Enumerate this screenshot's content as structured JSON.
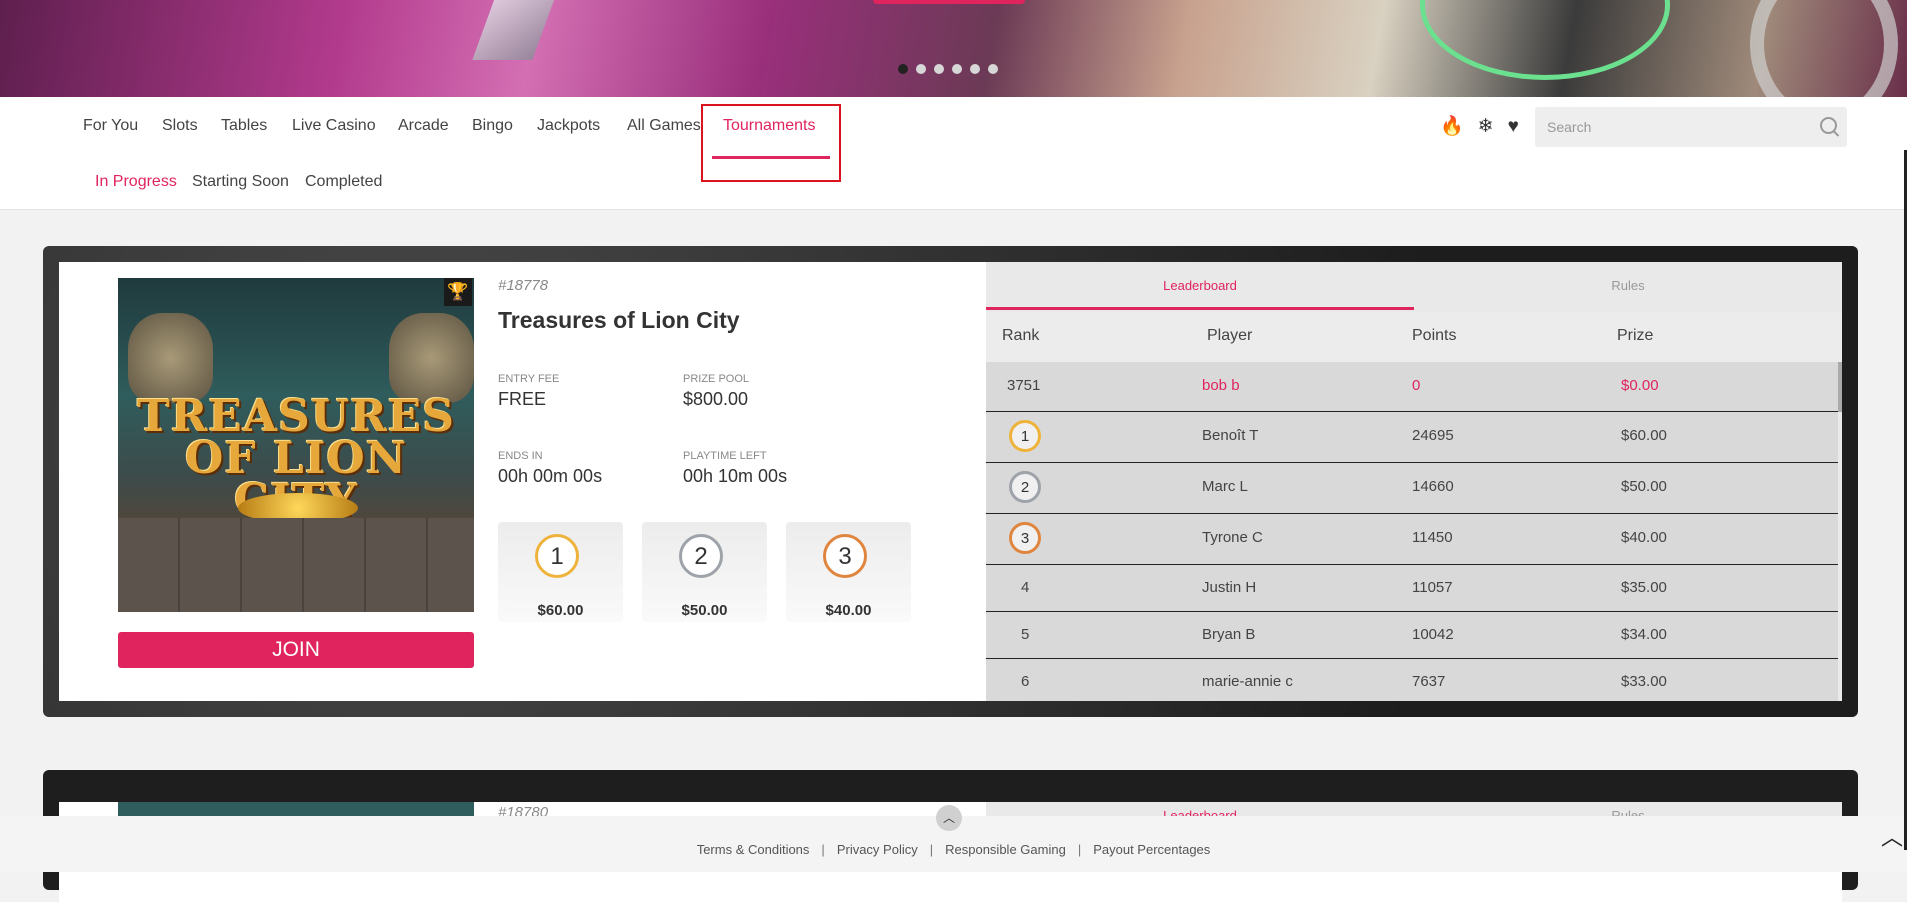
{
  "nav": {
    "items": [
      "For You",
      "Slots",
      "Tables",
      "Live Casino",
      "Arcade",
      "Bingo",
      "Jackpots",
      "All Games",
      "Tournaments"
    ],
    "active": "Tournaments",
    "sub_items": [
      "In Progress",
      "Starting Soon",
      "Completed"
    ],
    "sub_active": "In Progress",
    "icons": [
      "fire-icon",
      "snowflake-icon",
      "heart-icon"
    ],
    "search_placeholder": "Search"
  },
  "carousel": {
    "slide_count": 6,
    "active_index": 0
  },
  "tournament": {
    "id": "#18778",
    "name": "Treasures of Lion City",
    "game_art_title": "TREASURES OF LION CITY",
    "entry_fee_label": "ENTRY FEE",
    "entry_fee": "FREE",
    "prize_pool_label": "PRIZE POOL",
    "prize_pool": "$800.00",
    "ends_in_label": "ENDS IN",
    "ends_in": "00h 00m 00s",
    "playtime_label": "PLAYTIME LEFT",
    "playtime_left": "00h 10m 00s",
    "join_label": "JOIN",
    "top_prizes": [
      {
        "rank": "1",
        "amount": "$60.00"
      },
      {
        "rank": "2",
        "amount": "$50.00"
      },
      {
        "rank": "3",
        "amount": "$40.00"
      }
    ]
  },
  "leaderboard": {
    "tabs": [
      "Leaderboard",
      "Rules"
    ],
    "active_tab": "Leaderboard",
    "columns": [
      "Rank",
      "Player",
      "Points",
      "Prize"
    ],
    "me": {
      "rank": "3751",
      "player": "bob b",
      "points": "0",
      "prize": "$0.00"
    },
    "rows": [
      {
        "rank": "1",
        "player": "Benoît T",
        "points": "24695",
        "prize": "$60.00"
      },
      {
        "rank": "2",
        "player": "Marc L",
        "points": "14660",
        "prize": "$50.00"
      },
      {
        "rank": "3",
        "player": "Tyrone C",
        "points": "11450",
        "prize": "$40.00"
      },
      {
        "rank": "4",
        "player": "Justin H",
        "points": "11057",
        "prize": "$35.00"
      },
      {
        "rank": "5",
        "player": "Bryan B",
        "points": "10042",
        "prize": "$34.00"
      },
      {
        "rank": "6",
        "player": "marie-annie c",
        "points": "7637",
        "prize": "$33.00"
      }
    ]
  },
  "tournament2": {
    "id": "#18780",
    "tabs": [
      "Leaderboard",
      "Rules"
    ]
  },
  "footer": {
    "links": [
      "Terms & Conditions",
      "Privacy Policy",
      "Responsible Gaming",
      "Payout Percentages"
    ],
    "separator": "|"
  },
  "colors": {
    "accent": "#e0245e",
    "gold": "#eeb33b",
    "silver": "#9ea3aa",
    "bronze": "#e0853e"
  }
}
